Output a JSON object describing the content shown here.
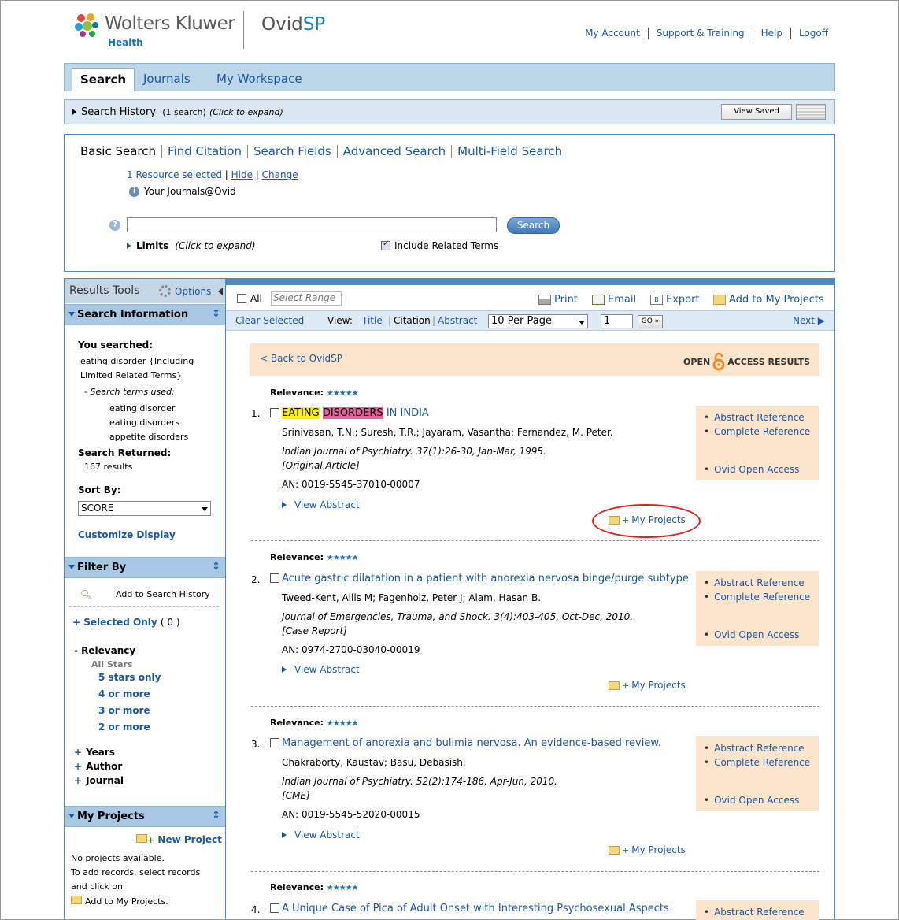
{
  "header": {
    "brand": "Wolters Kluwer",
    "brand_sub": "Health",
    "product_prefix": "Ovid",
    "product_suffix": "SP",
    "links": [
      "My Account",
      "Support & Training",
      "Help",
      "Logoff"
    ]
  },
  "tabs": [
    "Search",
    "Journals",
    "My Workspace"
  ],
  "history": {
    "label": "Search History",
    "count": "(1 search)",
    "hint": "(Click to expand)",
    "view_saved": "View Saved"
  },
  "search": {
    "tabs": [
      "Basic Search",
      "Find Citation",
      "Search Fields",
      "Advanced Search",
      "Multi-Field Search"
    ],
    "resource_selected": "1 Resource selected",
    "hide": "Hide",
    "change": "Change",
    "resource_name": "Your Journals@Ovid",
    "button": "Search",
    "limits": "Limits",
    "limits_hint": "(Click to expand)",
    "include_related": "Include Related Terms"
  },
  "left": {
    "results_tools": "Results Tools",
    "options": "Options",
    "search_info": "Search Information",
    "you_searched": "You searched:",
    "query_line1": "eating disorder {Including",
    "query_line2": "Limited Related Terms}",
    "terms_used": "- Search terms used:",
    "terms": [
      "eating disorder",
      "eating disorders",
      "appetite disorders"
    ],
    "search_returned": "Search Returned:",
    "results_count": "167 results",
    "sort_by": "Sort By:",
    "sort_value": "SCORE",
    "customize": "Customize Display",
    "filter_by": "Filter By",
    "add_to_history": "Add to Search History",
    "selected_only": "+ Selected Only",
    "selected_count": "( 0 )",
    "relevancy": "- Relevancy",
    "all_stars": "All Stars",
    "star_filters": [
      "5 stars only",
      "4 or more",
      "3 or more",
      "2 or more"
    ],
    "years": "Years",
    "author": "Author",
    "journal": "Journal",
    "my_projects": "My Projects",
    "new_project": "New Project",
    "np_line1": "No projects available.",
    "np_line2": "To add records, select records",
    "np_line3": "and click on",
    "np_line4": "Add to My Projects."
  },
  "toolbar": {
    "all": "All",
    "select_range": "Select Range",
    "print": "Print",
    "email": "Email",
    "export": "Export",
    "add_projects": "Add to My Projects",
    "clear_selected": "Clear Selected",
    "view_label": "View:",
    "views": [
      "Title",
      "Citation",
      "Abstract"
    ],
    "per_page": "10 Per Page",
    "page": "1",
    "go": "GO »",
    "next": "Next"
  },
  "banner": {
    "back": "< Back to OvidSP",
    "open": "OPEN",
    "access": "ACCESS RESULTS"
  },
  "results": [
    {
      "num": "1.",
      "relevance": "Relevance:",
      "title_hl1": "EATING",
      "title_hl2": "DISORDERS",
      "title": " IN INDIA",
      "authors": "Srinivasan, T.N.; Suresh, T.R.; Jayaram, Vasantha; Fernandez, M. Peter.",
      "source": "Indian Journal of Psychiatry. 37(1):26-30, Jan-Mar, 1995.",
      "type": "[Original Article]",
      "an": "AN: 0019-5545-37010-00007",
      "view_abstract": "View Abstract",
      "my_projects": "My Projects",
      "refs": [
        "Abstract Reference",
        "Complete Reference",
        "Ovid Open Access"
      ]
    },
    {
      "num": "2.",
      "relevance": "Relevance:",
      "title": "Acute gastric dilatation in a patient with anorexia nervosa binge/purge subtype",
      "authors": "Tweed-Kent, Ailis M; Fagenholz, Peter J; Alam, Hasan B.",
      "source": "Journal of Emergencies, Trauma, and Shock. 3(4):403-405, Oct-Dec, 2010.",
      "type": "[Case Report]",
      "an": "AN: 0974-2700-03040-00019",
      "view_abstract": "View Abstract",
      "my_projects": "My Projects",
      "refs": [
        "Abstract Reference",
        "Complete Reference",
        "Ovid Open Access"
      ]
    },
    {
      "num": "3.",
      "relevance": "Relevance:",
      "title": "Management of anorexia and bulimia nervosa. An evidence-based review.",
      "authors": "Chakraborty, Kaustav; Basu, Debasish.",
      "source": "Indian Journal of Psychiatry. 52(2):174-186, Apr-Jun, 2010.",
      "type": "[CME]",
      "an": "AN: 0019-5545-52020-00015",
      "view_abstract": "View Abstract",
      "my_projects": "My Projects",
      "refs": [
        "Abstract Reference",
        "Complete Reference",
        "Ovid Open Access"
      ]
    },
    {
      "num": "4.",
      "relevance": "Relevance:",
      "title": "A Unique Case of Pica of Adult Onset with Interesting Psychosexual Aspects",
      "refs": [
        "Abstract Reference"
      ]
    }
  ]
}
